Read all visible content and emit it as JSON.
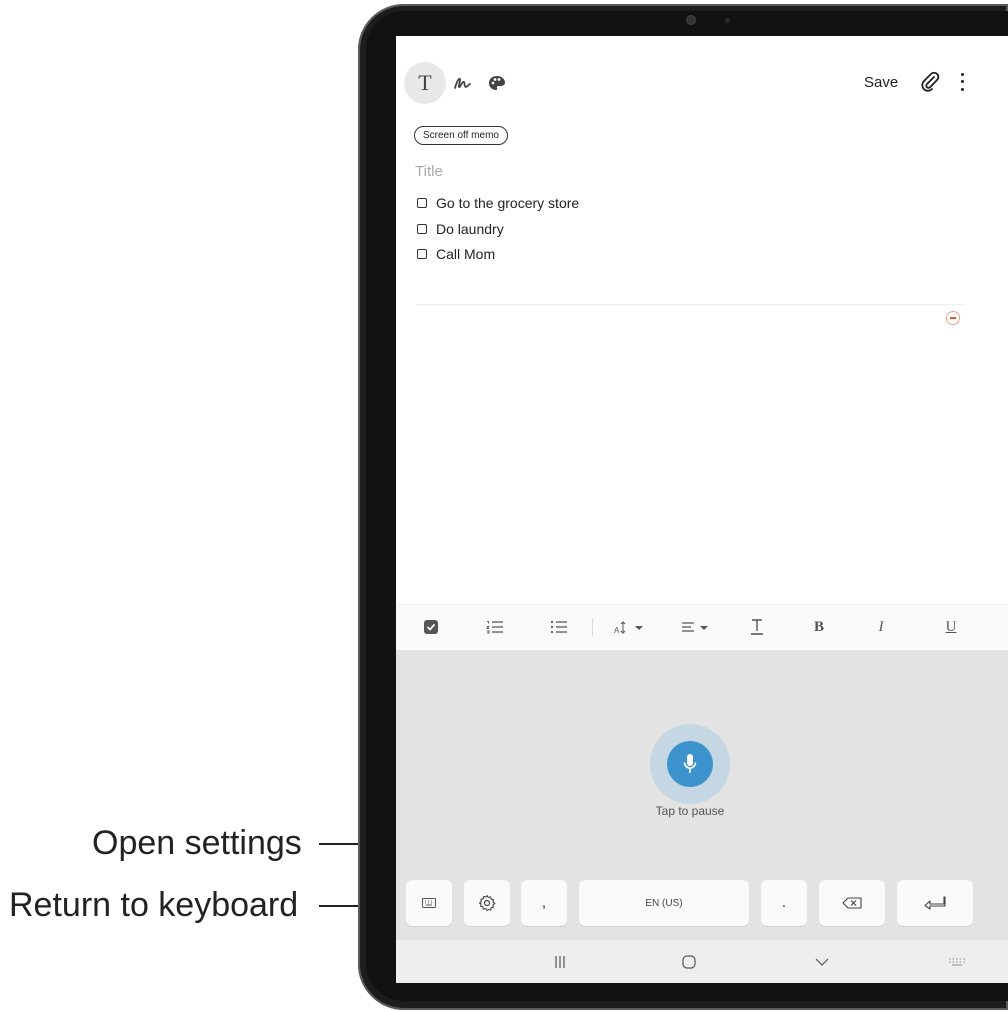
{
  "toolbar": {
    "text_mode_icon": "T",
    "handwriting_icon": "handwriting-icon",
    "brush_icon": "paint-palette-icon",
    "save_label": "Save",
    "attach_icon": "paperclip-icon",
    "more_icon": "more-vert-icon"
  },
  "note": {
    "badge": "Screen off memo",
    "title_placeholder": "Title",
    "checklist": [
      {
        "label": "Go to the grocery store",
        "checked": false
      },
      {
        "label": "Do laundry",
        "checked": false
      },
      {
        "label": "Call Mom",
        "checked": false
      }
    ],
    "remove_icon": "minus-circle-icon"
  },
  "format_bar": {
    "items": [
      "checkbox-icon",
      "numbered-list-icon",
      "bulleted-list-icon",
      "font-size-icon",
      "align-icon",
      "text-color-icon",
      "B",
      "I",
      "U"
    ]
  },
  "voice": {
    "status_label": "Tap to pause",
    "mic_icon": "microphone-icon",
    "accent": "#3d94cc"
  },
  "keyboard_row": {
    "comma": ",",
    "space_label": "EN (US)",
    "period": "."
  },
  "callouts": {
    "open_settings": "Open settings",
    "return_to_keyboard": "Return to keyboard"
  }
}
